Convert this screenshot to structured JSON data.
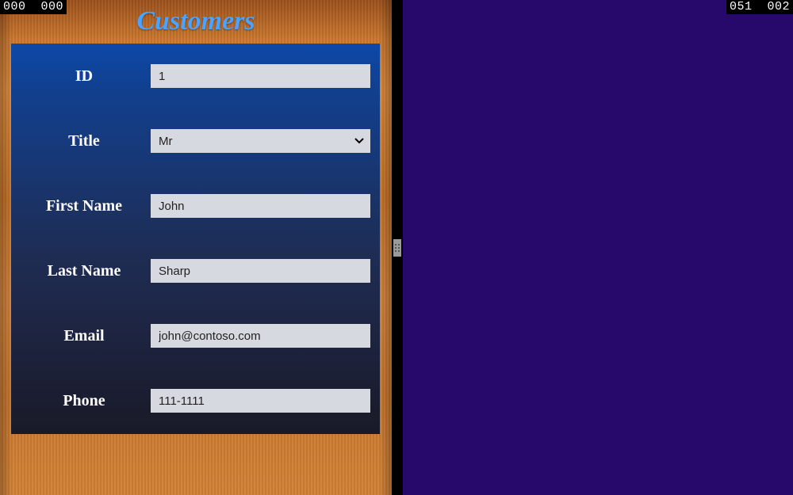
{
  "overlay": {
    "top_left": "000  000",
    "top_right": "051  002"
  },
  "app": {
    "title": "Customers"
  },
  "form": {
    "id": {
      "label": "ID",
      "value": "1"
    },
    "title": {
      "label": "Title",
      "value": "Mr"
    },
    "firstName": {
      "label": "First Name",
      "value": "John"
    },
    "lastName": {
      "label": "Last Name",
      "value": "Sharp"
    },
    "email": {
      "label": "Email",
      "value": "john@contoso.com"
    },
    "phone": {
      "label": "Phone",
      "value": "111-1111"
    }
  }
}
